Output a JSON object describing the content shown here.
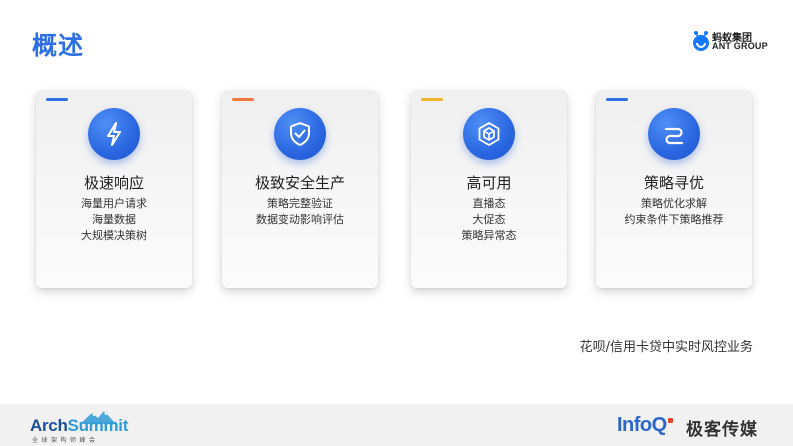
{
  "slide": {
    "title": "概述"
  },
  "brand": {
    "cn": "蚂蚁集团",
    "en": "ANT GROUP"
  },
  "cards": [
    {
      "title": "极速响应",
      "lines": [
        "海量用户请求",
        "海量数据",
        "大规模决策树"
      ],
      "icon": "lightning-bolt-icon",
      "accent": "#2f6fe4"
    },
    {
      "title": "极致安全生产",
      "lines": [
        "策略完整验证",
        "数据变动影响评估"
      ],
      "icon": "shield-check-icon",
      "accent": "#f07a3a"
    },
    {
      "title": "高可用",
      "lines": [
        "直播态",
        "大促态",
        "策略异常态"
      ],
      "icon": "cube-icon",
      "accent": "#f0b429"
    },
    {
      "title": "策略寻优",
      "lines": [
        "策略优化求解",
        "约束条件下策略推荐"
      ],
      "icon": "route-icon",
      "accent": "#2f6fe4"
    }
  ],
  "caption": "花呗/信用卡贷中实时风控业务",
  "footer": {
    "archsummit_a": "Arch",
    "archsummit_b": "Summit",
    "archsummit_sub": "全球架构师峰会",
    "infoq": "InfoQ",
    "geek": "极客传媒"
  }
}
